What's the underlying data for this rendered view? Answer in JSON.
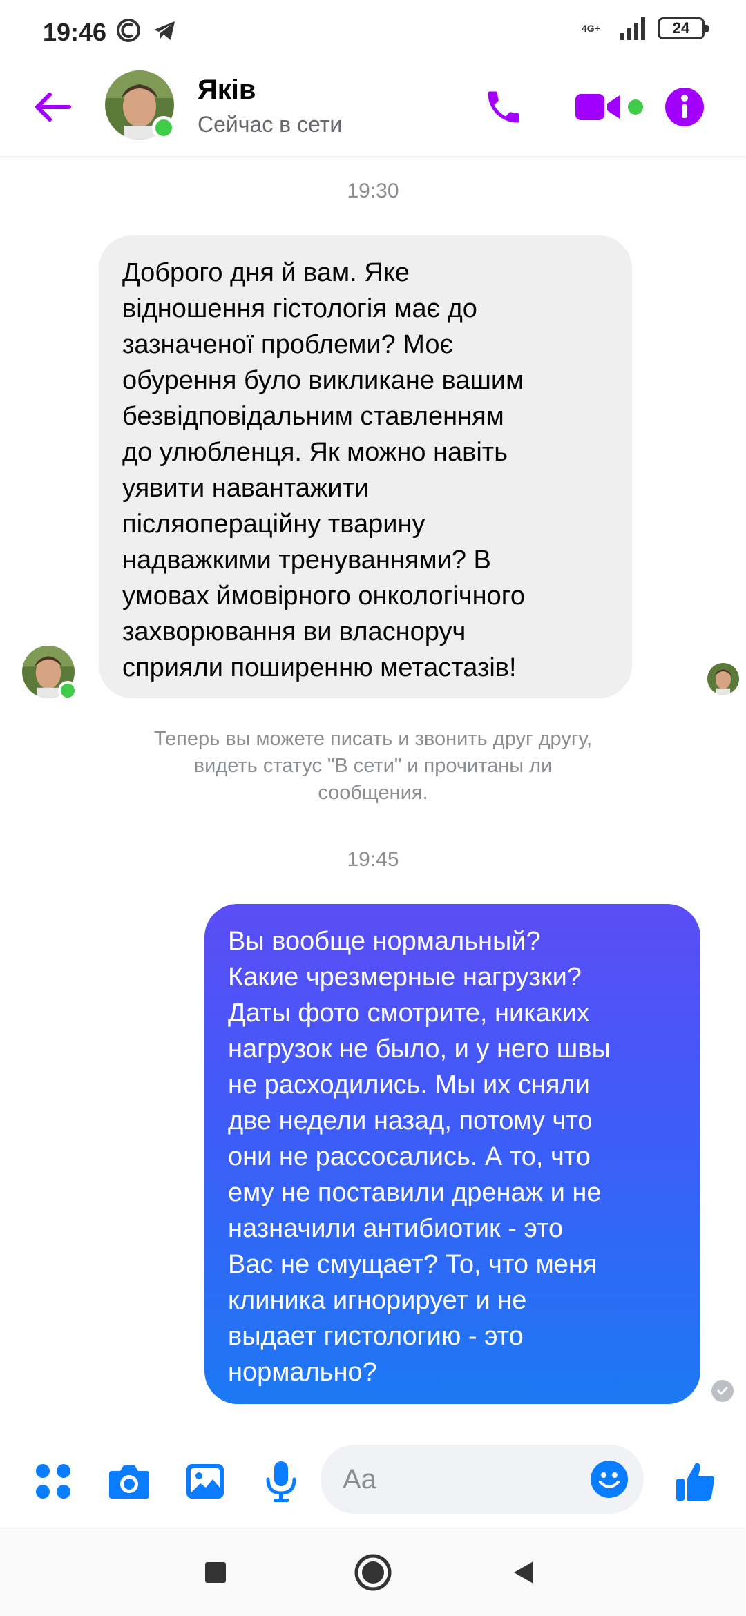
{
  "status_bar": {
    "time": "19:46",
    "network": "4G+",
    "battery": "24",
    "icons": [
      "c-app-icon",
      "telegram-icon",
      "signal-icon",
      "battery-icon"
    ]
  },
  "header": {
    "contact_name": "Яків",
    "contact_status": "Сейчас в сети",
    "accent_color": "#a100ff",
    "online_color": "#3fcc48",
    "icons": [
      "back-arrow-icon",
      "phone-icon",
      "video-camera-icon",
      "info-icon"
    ]
  },
  "messages": [
    {
      "timestamp": "19:30",
      "direction": "incoming",
      "text": "Доброго дня й вам. Яке\nвідношення гістологія має до\nзазначеної проблеми? Моє\nобурення було викликане вашим\nбезвідповідальним ставленням\nдо улюбленця. Як можно навіть\nуявити навантажити\nпісляопераційну тварину\nнадважкими тренуваннями? В\nумовах ймовірного онкологічного\nзахворювання ви власноруч\nсприяли поширенню метастазів!"
    },
    {
      "system": "Теперь вы можете писать и звонить друг другу,\nвидеть статус \"В сети\" и прочитаны ли\nсообщения."
    },
    {
      "timestamp": "19:45",
      "direction": "outgoing",
      "text": "Вы вообще нормальный?\nКакие чрезмерные нагрузки?\nДаты фото смотрите, никаких\nнагрузок не было, и у него швы\nне расходились. Мы их сняли\nдве недели назад, потому что\nони не рассосались. А то, что\nему не поставили дренаж и не\nназначили антибиотик - это\nВас не смущает? То, что меня\nклиника игнорирует и не\nвыдает гистологию - это\nнормально?"
    }
  ],
  "composer": {
    "placeholder": "Aa",
    "accent_color": "#0a7cff",
    "icons": [
      "apps-grid-icon",
      "camera-icon",
      "gallery-icon",
      "microphone-icon",
      "emoji-icon",
      "thumbs-up-icon"
    ]
  },
  "navbar": {
    "icons": [
      "recent-apps-icon",
      "home-icon",
      "back-icon"
    ]
  }
}
